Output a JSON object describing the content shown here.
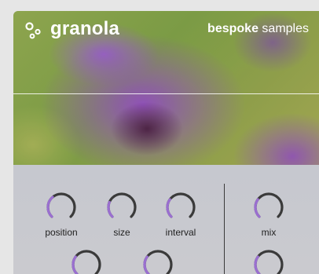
{
  "header": {
    "app_name": "granola",
    "vendor_bold": "bespoke",
    "vendor_rest": " samples",
    "logo_icon": "granola-dots-icon"
  },
  "knobs": [
    {
      "label": "position",
      "value": 0.35
    },
    {
      "label": "size",
      "value": 0.25
    },
    {
      "label": "interval",
      "value": 0.3
    },
    {
      "label": "mix",
      "value": 0.3
    },
    {
      "label": "",
      "value": 0.3
    },
    {
      "label": "",
      "value": 0.3
    },
    {
      "label": "",
      "value": 0.3
    }
  ],
  "colors": {
    "knob_track": "#3a3a3a",
    "knob_value": "#9a6fd0",
    "text_light": "#ffffff"
  }
}
